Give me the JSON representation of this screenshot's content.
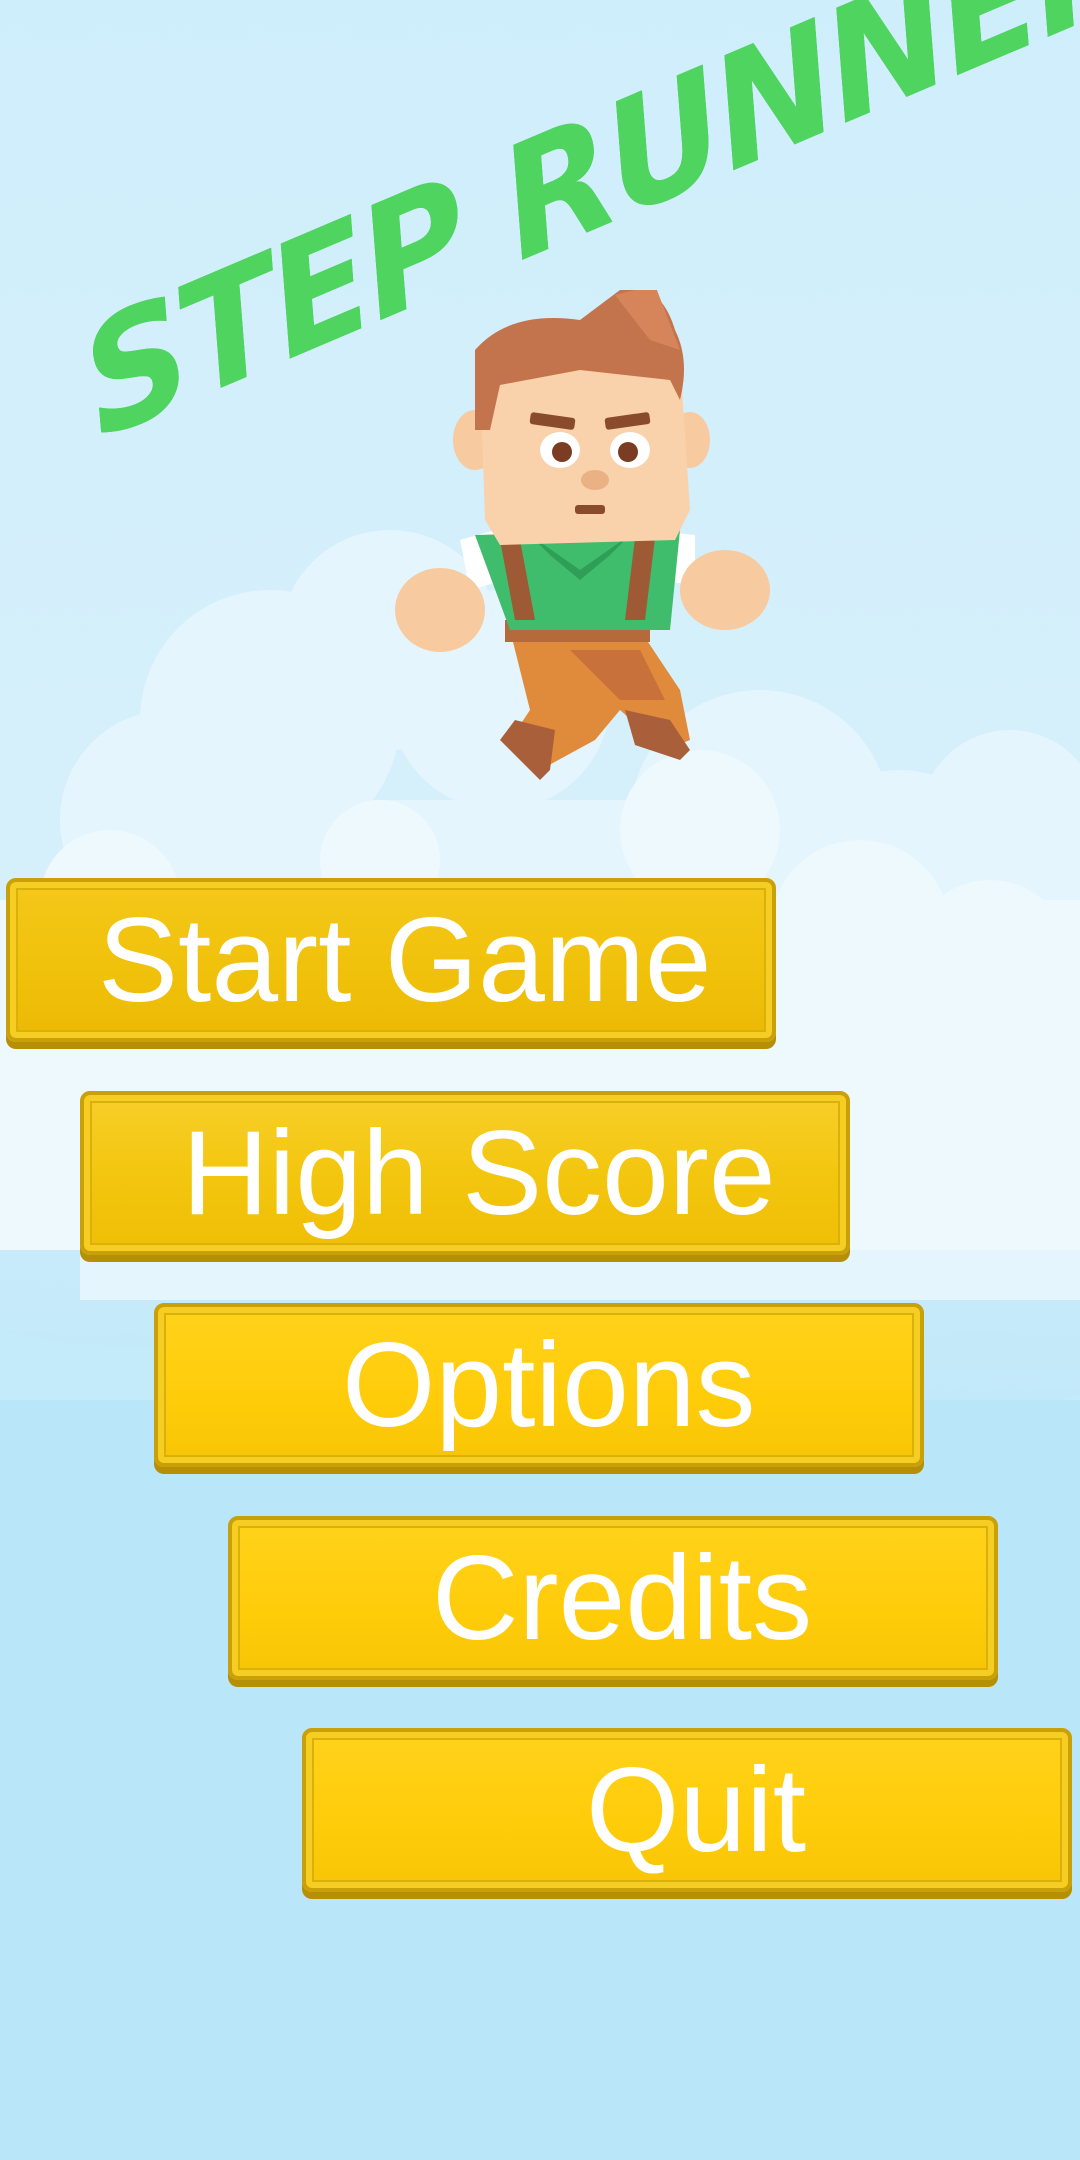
{
  "game": {
    "title": "STEP RUNNER"
  },
  "menu": {
    "buttons": [
      {
        "id": "start",
        "label": "Start Game"
      },
      {
        "id": "high_score",
        "label": "High Score"
      },
      {
        "id": "options",
        "label": "Options"
      },
      {
        "id": "credits",
        "label": "Credits"
      },
      {
        "id": "quit",
        "label": "Quit"
      }
    ]
  },
  "colors": {
    "sky": "#cfeefb",
    "title_green": "#4fd45f",
    "button_yellow": "#ffcc0a",
    "button_border": "#c9a008",
    "button_text": "#ffffff"
  }
}
